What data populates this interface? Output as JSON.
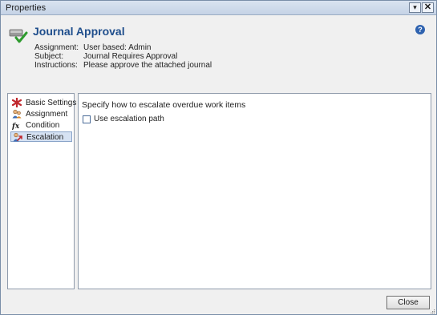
{
  "window": {
    "title": "Properties",
    "minimize_glyph": "▾",
    "close_glyph": "✕"
  },
  "header": {
    "title": "Journal Approval",
    "icon": "workflow-approval-check-icon",
    "help_icon": "help-icon",
    "fields": [
      {
        "label": "Assignment:",
        "value": "User based: Admin"
      },
      {
        "label": "Subject:",
        "value": "Journal Requires Approval"
      },
      {
        "label": "Instructions:",
        "value": "Please approve the attached journal"
      }
    ]
  },
  "nav": {
    "items": [
      {
        "label": "Basic Settings",
        "icon": "red-star-icon",
        "selected": false
      },
      {
        "label": "Assignment",
        "icon": "users-icon",
        "selected": false
      },
      {
        "label": "Condition",
        "icon": "function-fx-icon",
        "selected": false
      },
      {
        "label": "Escalation",
        "icon": "escalation-users-icon",
        "selected": true
      }
    ]
  },
  "content": {
    "heading": "Specify how to escalate overdue work items",
    "checkbox_label": "Use escalation path",
    "checkbox_checked": false
  },
  "footer": {
    "close_label": "Close"
  },
  "colors": {
    "title_blue": "#1f4e8c",
    "selection": "#d6e2f3",
    "border": "#8f9bab"
  }
}
